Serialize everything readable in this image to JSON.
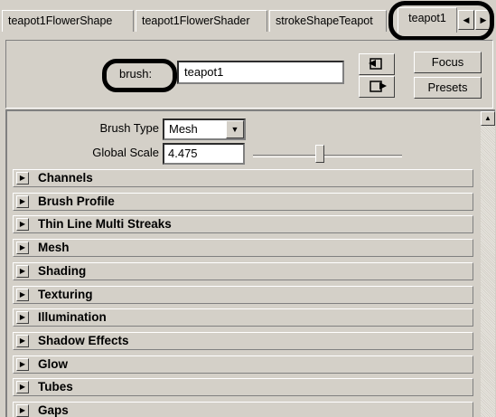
{
  "tabs": [
    {
      "label": "teapot1FlowerShape",
      "active": false
    },
    {
      "label": "teapot1FlowerShader",
      "active": false
    },
    {
      "label": "strokeShapeTeapot",
      "active": false
    },
    {
      "label": "teapot1",
      "active": true
    }
  ],
  "tab_scroll": {
    "left_icon": "triangle-left-icon",
    "right_icon": "triangle-right-icon"
  },
  "header": {
    "brush_label": "brush:",
    "brush_value": "teapot1",
    "focus_label": "Focus",
    "presets_label": "Presets",
    "select_icon": "select-node-icon",
    "copy_tab_icon": "copy-tab-icon"
  },
  "attributes": {
    "brush_type_label": "Brush Type",
    "brush_type_value": "Mesh",
    "global_scale_label": "Global Scale",
    "global_scale_value": "4.475",
    "global_scale_slider_level": 0.45
  },
  "sections": [
    {
      "label": "Channels"
    },
    {
      "label": "Brush Profile"
    },
    {
      "label": "Thin Line Multi Streaks"
    },
    {
      "label": "Mesh"
    },
    {
      "label": "Shading"
    },
    {
      "label": "Texturing"
    },
    {
      "label": "Illumination"
    },
    {
      "label": "Shadow Effects"
    },
    {
      "label": "Glow"
    },
    {
      "label": "Tubes"
    },
    {
      "label": "Gaps"
    }
  ],
  "colors": {
    "panel_bg": "#d4d0c8",
    "annotation": "#000000"
  }
}
